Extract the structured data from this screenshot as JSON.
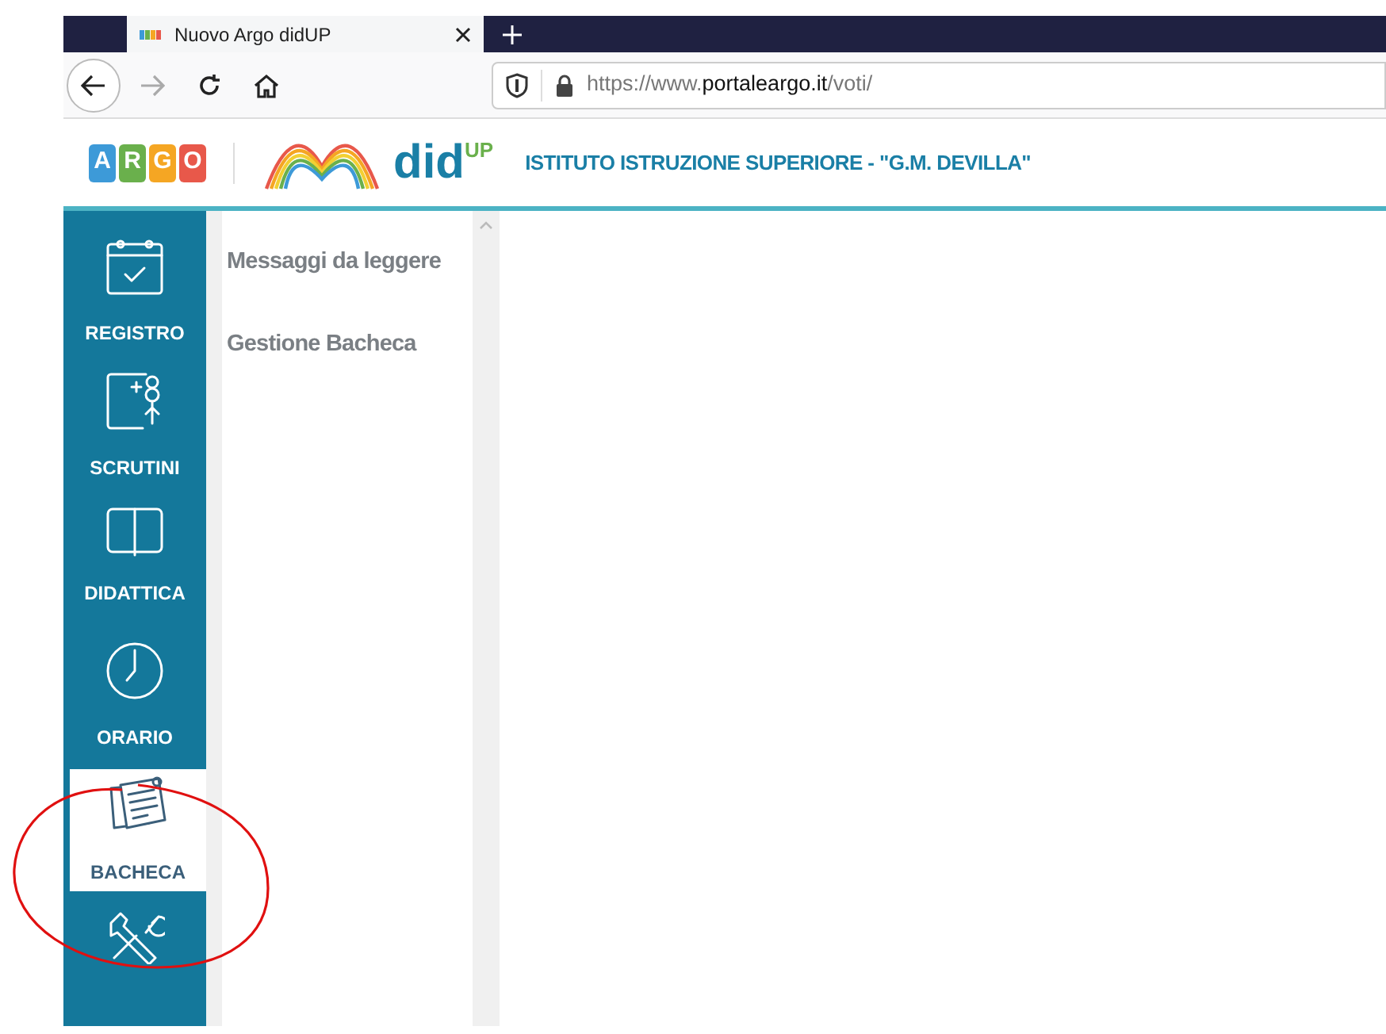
{
  "browser": {
    "tab_title": "Nuovo Argo didUP",
    "url_prefix": "https://www.",
    "url_domain": "portaleargo.it",
    "url_path": "/voti/"
  },
  "header": {
    "argo_letters": [
      "A",
      "R",
      "G",
      "O"
    ],
    "app_name": "did",
    "app_suffix": "UP",
    "school": "ISTITUTO ISTRUZIONE SUPERIORE - \"G.M. DEVILLA\""
  },
  "sidebar": {
    "items": [
      {
        "kind": "calendar",
        "label": "REGISTRO",
        "selected": false
      },
      {
        "kind": "scrutini",
        "label": "SCRUTINI",
        "selected": false
      },
      {
        "kind": "book",
        "label": "DIDATTICA",
        "selected": false
      },
      {
        "kind": "clock",
        "label": "ORARIO",
        "selected": false
      },
      {
        "kind": "notes",
        "label": "BACHECA",
        "selected": true
      },
      {
        "kind": "tools",
        "selected": false
      }
    ]
  },
  "submenu": {
    "items": [
      "Messaggi da leggere",
      "Gestione Bacheca"
    ]
  }
}
